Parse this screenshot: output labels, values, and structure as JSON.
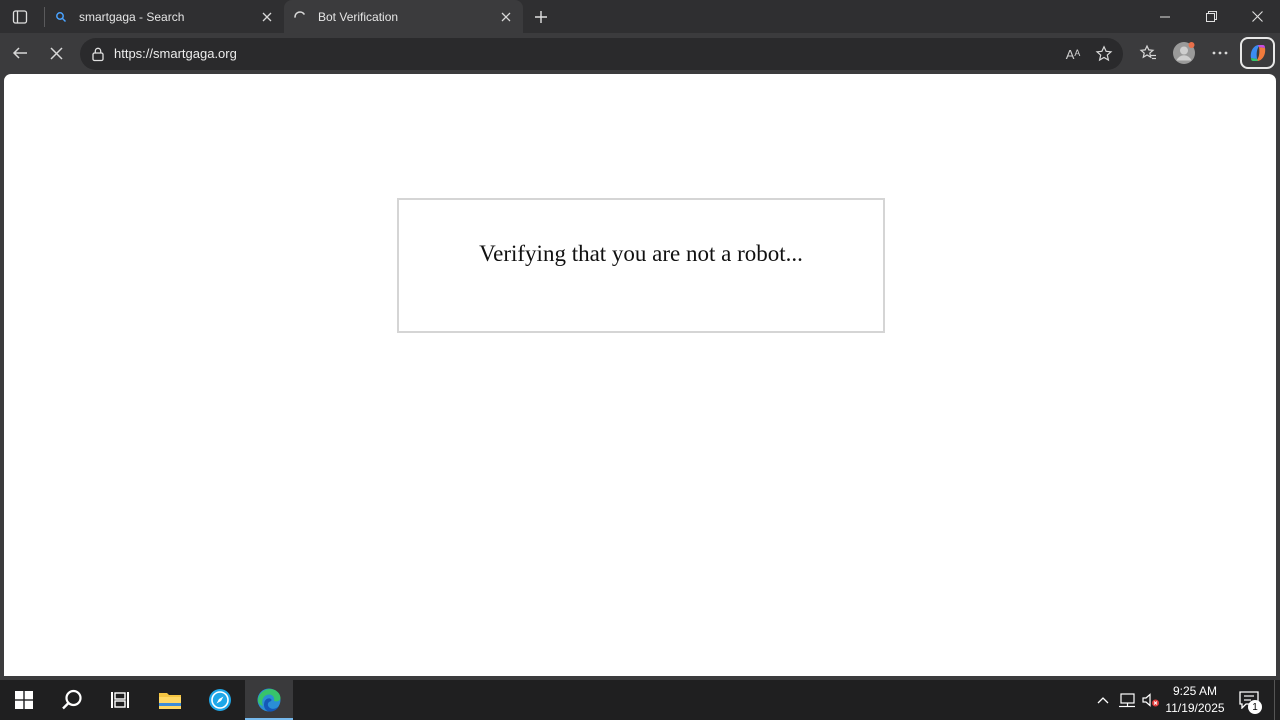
{
  "browser": {
    "tabs": [
      {
        "title": "smartgaga - Search",
        "favicon": "search-icon",
        "active": false
      },
      {
        "title": "Bot Verification",
        "favicon": "loading-spinner-icon",
        "active": true
      }
    ],
    "address": {
      "url": "https://smartgaga.org"
    },
    "read_aloud_label": "Aᴬ"
  },
  "page": {
    "verify_text": "Verifying that you are not a robot..."
  },
  "taskbar": {
    "time": "9:25 AM",
    "date": "11/19/2025",
    "notification_count": "1"
  },
  "colors": {
    "chrome_dark": "#2f2f31",
    "toolbar": "#3b3b3d",
    "page_bg": "#ffffff",
    "taskbar": "#1f1f20",
    "accent": "#76b9ed"
  }
}
